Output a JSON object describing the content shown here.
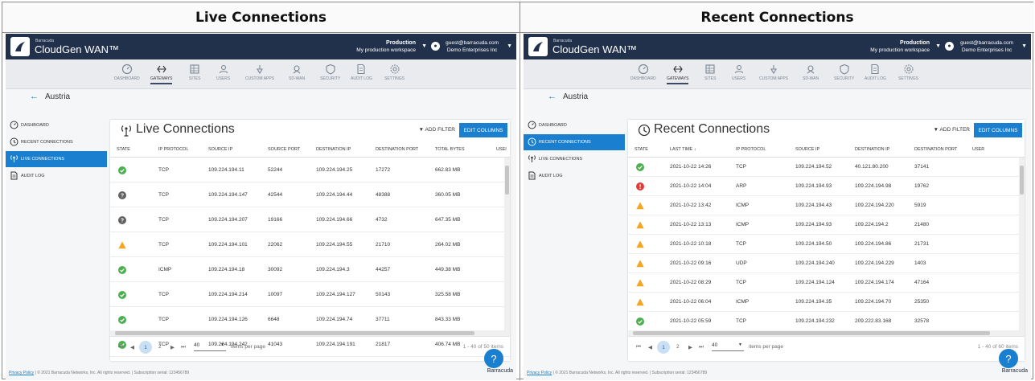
{
  "headers": {
    "left": "Live Connections",
    "right": "Recent Connections"
  },
  "app": {
    "brand_small": "Barracuda",
    "brand": "CloudGen WAN™",
    "workspace_name": "Production",
    "workspace_desc": "My production workspace",
    "user_email": "guest@barracuda.com",
    "user_org": "Demo Enterprises Inc"
  },
  "nav": [
    "DASHBOARD",
    "GATEWAYS",
    "SITES",
    "USERS",
    "CUSTOM APPS",
    "SD-WAN",
    "SECURITY",
    "AUDIT LOG",
    "SETTINGS"
  ],
  "back_label": "Austria",
  "sidebar": [
    "DASHBOARD",
    "RECENT CONNECTIONS",
    "LIVE CONNECTIONS",
    "AUDIT LOG"
  ],
  "actions": {
    "add_filter": "ADD FILTER",
    "edit_columns": "EDIT COLUMNS"
  },
  "live": {
    "title": "Live Connections",
    "columns": [
      "STATE",
      "IP PROTOCOL",
      "SOURCE IP",
      "SOURCE PORT",
      "DESTINATION IP",
      "DESTINATION PORT",
      "TOTAL BYTES",
      "USEI"
    ],
    "rows": [
      {
        "state": "ok",
        "protocol": "TCP",
        "source_ip": "109.224.194.11",
        "source_port": "52244",
        "dest_ip": "109.224.194.25",
        "dest_port": "17272",
        "bytes": "662.83 MB"
      },
      {
        "state": "unknown",
        "protocol": "TCP",
        "source_ip": "109.224.194.147",
        "source_port": "42544",
        "dest_ip": "109.224.194.44",
        "dest_port": "48388",
        "bytes": "360.05 MB"
      },
      {
        "state": "unknown",
        "protocol": "TCP",
        "source_ip": "109.224.194.207",
        "source_port": "19166",
        "dest_ip": "109.224.194.66",
        "dest_port": "4732",
        "bytes": "647.35 MB"
      },
      {
        "state": "warning",
        "protocol": "TCP",
        "source_ip": "109.224.194.101",
        "source_port": "22062",
        "dest_ip": "109.224.194.55",
        "dest_port": "21710",
        "bytes": "264.02 MB"
      },
      {
        "state": "ok",
        "protocol": "ICMP",
        "source_ip": "109.224.194.18",
        "source_port": "30092",
        "dest_ip": "109.224.194.3",
        "dest_port": "44257",
        "bytes": "449.38 MB"
      },
      {
        "state": "ok",
        "protocol": "TCP",
        "source_ip": "109.224.194.214",
        "source_port": "10097",
        "dest_ip": "109.224.194.127",
        "dest_port": "50143",
        "bytes": "325.58 MB"
      },
      {
        "state": "ok",
        "protocol": "TCP",
        "source_ip": "109.224.194.126",
        "source_port": "6648",
        "dest_ip": "109.224.194.74",
        "dest_port": "37711",
        "bytes": "843.33 MB"
      },
      {
        "state": "ok",
        "protocol": "TCP",
        "source_ip": "109.224.194.242",
        "source_port": "41043",
        "dest_ip": "109.224.194.191",
        "dest_port": "21817",
        "bytes": "406.74 MB"
      }
    ],
    "pager": {
      "page1": "1",
      "page2": "2",
      "per_page": "40",
      "per_page_label": "items per page",
      "info": "1 - 40 of 50 items"
    }
  },
  "recent": {
    "title": "Recent Connections",
    "columns": [
      "STATE",
      "LAST TIME ↓",
      "IP PROTOCOL",
      "SOURCE IP",
      "DESTINATION IP",
      "DESTINATION PORT",
      "USER"
    ],
    "rows": [
      {
        "state": "ok",
        "time": "2021-10-22 14:26",
        "protocol": "TCP",
        "source_ip": "109.224.194.52",
        "dest_ip": "40.121.80.200",
        "dest_port": "37141"
      },
      {
        "state": "error",
        "time": "2021-10-22 14:04",
        "protocol": "ARP",
        "source_ip": "109.224.194.93",
        "dest_ip": "109.224.194.98",
        "dest_port": "19762"
      },
      {
        "state": "warning",
        "time": "2021-10-22 13:42",
        "protocol": "ICMP",
        "source_ip": "109.224.194.43",
        "dest_ip": "109.224.194.220",
        "dest_port": "5919"
      },
      {
        "state": "warning",
        "time": "2021-10-22 13:13",
        "protocol": "ICMP",
        "source_ip": "109.224.194.93",
        "dest_ip": "109.224.194.2",
        "dest_port": "21480"
      },
      {
        "state": "warning",
        "time": "2021-10-22 10:18",
        "protocol": "TCP",
        "source_ip": "109.224.194.50",
        "dest_ip": "109.224.194.86",
        "dest_port": "21731"
      },
      {
        "state": "warning",
        "time": "2021-10-22 09:16",
        "protocol": "UDP",
        "source_ip": "109.224.194.240",
        "dest_ip": "109.224.194.229",
        "dest_port": "1403"
      },
      {
        "state": "warning",
        "time": "2021-10-22 08:29",
        "protocol": "TCP",
        "source_ip": "109.224.194.124",
        "dest_ip": "109.224.194.174",
        "dest_port": "47164"
      },
      {
        "state": "warning",
        "time": "2021-10-22 06:04",
        "protocol": "ICMP",
        "source_ip": "109.224.194.35",
        "dest_ip": "109.224.194.70",
        "dest_port": "25350"
      },
      {
        "state": "ok",
        "time": "2021-10-22 05:59",
        "protocol": "TCP",
        "source_ip": "109.224.194.232",
        "dest_ip": "209.222.83.168",
        "dest_port": "32578"
      }
    ],
    "pager": {
      "page1": "1",
      "page2": "2",
      "per_page": "40",
      "per_page_label": "items per page",
      "info": "1 - 40 of 60 items"
    }
  },
  "footer": {
    "privacy": "Privacy Policy",
    "text": " | © 2021 Barracuda Networks, Inc. All rights reserved. | Subscription serial: 123456789",
    "logo": "Barracuda"
  },
  "colors": {
    "ok": "#4caf50",
    "warning": "#f5a623",
    "error": "#e53935",
    "unknown": "#616161",
    "accent": "#1a7fcf",
    "topbar": "#22314b"
  }
}
